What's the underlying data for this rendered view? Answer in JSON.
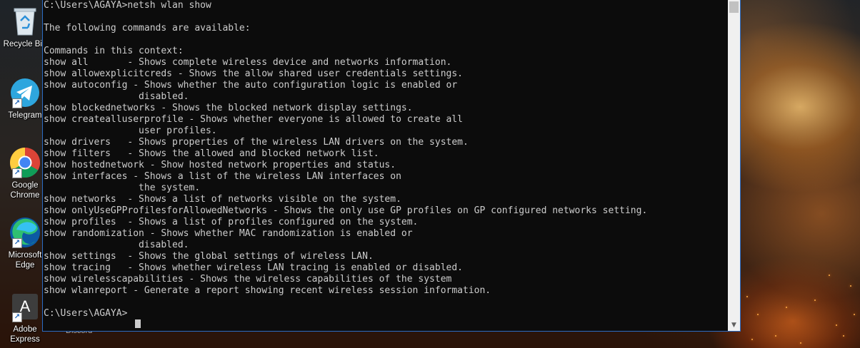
{
  "desktop": {
    "icons": [
      {
        "label": "Recycle Bin",
        "icon": "recycle-bin-icon",
        "shortcut": false
      },
      {
        "label": "Telegram",
        "icon": "telegram-icon",
        "shortcut": true
      },
      {
        "label": "Google\nChrome",
        "icon": "chrome-icon",
        "shortcut": true
      },
      {
        "label": "Microsoft\nEdge",
        "icon": "edge-icon",
        "shortcut": true
      },
      {
        "label": "Adobe\nExpress",
        "icon": "adobe-express-icon",
        "shortcut": true
      }
    ],
    "obscured_label": "Discord",
    "adobe_glyph": "A"
  },
  "console": {
    "lines": [
      "C:\\Users\\AGAYA>netsh wlan show",
      "",
      "The following commands are available:",
      "",
      "Commands in this context:",
      "show all       - Shows complete wireless device and networks information.",
      "show allowexplicitcreds - Shows the allow shared user credentials settings.",
      "show autoconfig - Shows whether the auto configuration logic is enabled or",
      "                 disabled.",
      "show blockednetworks - Shows the blocked network display settings.",
      "show createalluserprofile - Shows whether everyone is allowed to create all",
      "                 user profiles.",
      "show drivers   - Shows properties of the wireless LAN drivers on the system.",
      "show filters   - Shows the allowed and blocked network list.",
      "show hostednetwork - Show hosted network properties and status.",
      "show interfaces - Shows a list of the wireless LAN interfaces on",
      "                 the system.",
      "show networks  - Shows a list of networks visible on the system.",
      "show onlyUseGPProfilesforAllowedNetworks - Shows the only use GP profiles on GP configured networks setting.",
      "show profiles  - Shows a list of profiles configured on the system.",
      "show randomization - Shows whether MAC randomization is enabled or",
      "                 disabled.",
      "show settings  - Shows the global settings of wireless LAN.",
      "show tracing   - Shows whether wireless LAN tracing is enabled or disabled.",
      "show wirelesscapabilities - Shows the wireless capabilities of the system",
      "show wlanreport - Generate a report showing recent wireless session information.",
      "",
      "C:\\Users\\AGAYA>"
    ],
    "colors": {
      "background": "#0c0c0c",
      "text": "#cccccc",
      "border": "#2b6cc4"
    }
  }
}
